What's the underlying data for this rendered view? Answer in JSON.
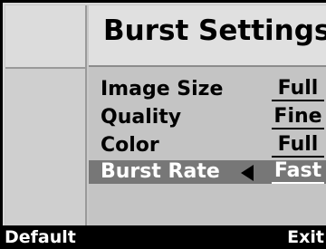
{
  "screen": {
    "title": "Burst Settings"
  },
  "menu": {
    "items": [
      {
        "label": "Image Size",
        "value": "Full"
      },
      {
        "label": "Quality",
        "value": "Fine"
      },
      {
        "label": "Color",
        "value": "Full"
      },
      {
        "label": "Burst Rate",
        "value": "Fast",
        "selected": true
      }
    ]
  },
  "softkeys": {
    "left": "Default",
    "right": "Exit"
  },
  "colors": {
    "selected_row": "#777777",
    "panel": "#c4c4c4",
    "title_bar": "#e0e0e0",
    "softkey_bar": "#000000"
  }
}
